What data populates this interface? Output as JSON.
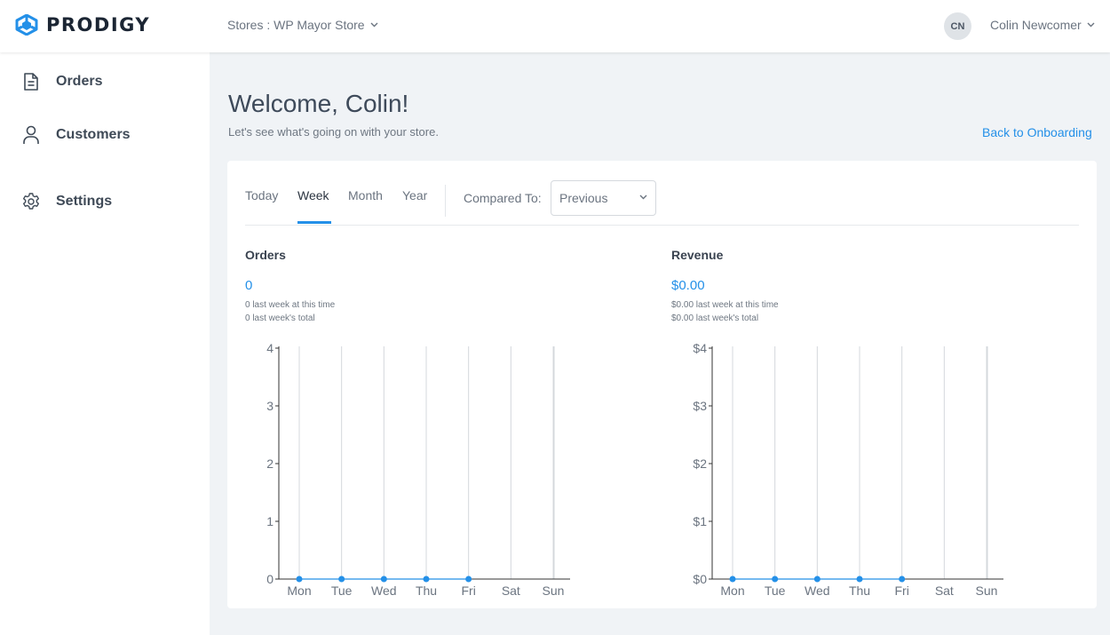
{
  "header": {
    "logo_text": "PRODIGY",
    "store_switcher": "Stores : WP Mayor Store",
    "user_initials": "CN",
    "user_name": "Colin Newcomer"
  },
  "sidebar": {
    "items": [
      {
        "label": "Orders",
        "icon": "document-icon"
      },
      {
        "label": "Customers",
        "icon": "user-icon"
      },
      {
        "label": "Settings",
        "icon": "gear-icon"
      }
    ]
  },
  "main": {
    "welcome": "Welcome, Colin!",
    "subtitle": "Let's see what's going on with your store.",
    "back_link": "Back to Onboarding",
    "tabs": [
      {
        "label": "Today"
      },
      {
        "label": "Week"
      },
      {
        "label": "Month"
      },
      {
        "label": "Year"
      }
    ],
    "active_tab": "Week",
    "compared_to_label": "Compared To:",
    "compared_to_value": "Previous",
    "orders": {
      "title": "Orders",
      "value": "0",
      "last_week_time": "0 last week at this time",
      "last_week_total": "0 last week's total"
    },
    "revenue": {
      "title": "Revenue",
      "value": "$0.00",
      "last_week_time": "$0.00 last week at this time",
      "last_week_total": "$0.00 last week's total"
    }
  },
  "colors": {
    "accent": "#2490e8",
    "sidebar_bg": "#ffffff",
    "page_bg": "#f0f3f6"
  },
  "chart_data": [
    {
      "type": "line",
      "categories": [
        "Mon",
        "Tue",
        "Wed",
        "Thu",
        "Fri",
        "Sat",
        "Sun"
      ],
      "series": [
        {
          "values": [
            0,
            0,
            0,
            0,
            0
          ]
        }
      ],
      "yticks": [
        "0",
        "1",
        "2",
        "3",
        "4"
      ],
      "ylim": [
        0,
        4
      ],
      "grid": "vertical",
      "color": "#2490e8"
    },
    {
      "type": "line",
      "categories": [
        "Mon",
        "Tue",
        "Wed",
        "Thu",
        "Fri",
        "Sat",
        "Sun"
      ],
      "series": [
        {
          "values": [
            0,
            0,
            0,
            0,
            0
          ]
        }
      ],
      "yticks": [
        "$0",
        "$1",
        "$2",
        "$3",
        "$4"
      ],
      "ylim": [
        0,
        4
      ],
      "grid": "vertical",
      "color": "#2490e8"
    }
  ]
}
